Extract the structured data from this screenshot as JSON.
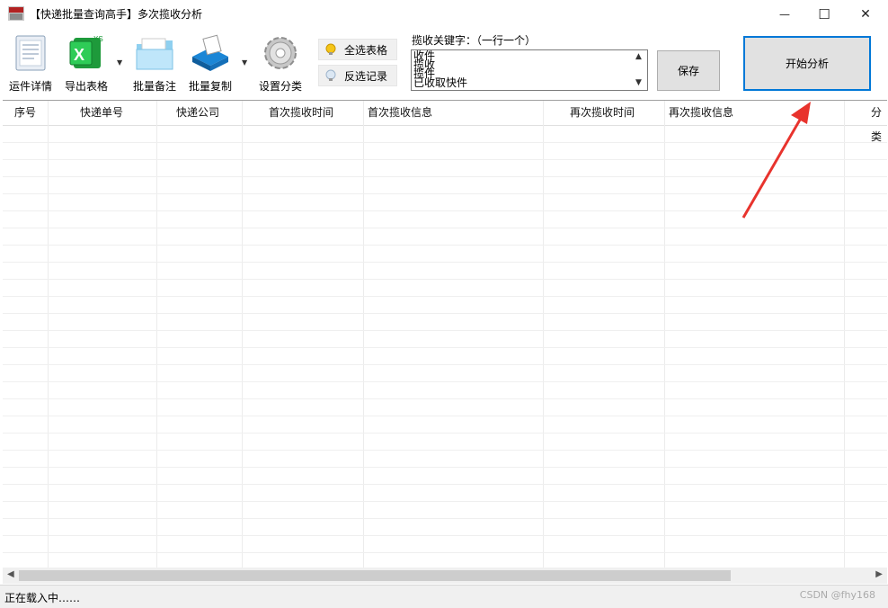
{
  "window": {
    "title": "【快递批量查询高手】多次揽收分析",
    "minimize": "—",
    "maximize": "☐",
    "close": "✕"
  },
  "toolbar": {
    "tools": [
      {
        "label": "运件详情",
        "icon": "document-icon"
      },
      {
        "label": "导出表格",
        "icon": "excel-icon"
      },
      {
        "label": "批量备注",
        "icon": "folder-icon"
      },
      {
        "label": "批量复制",
        "icon": "copy-icon"
      },
      {
        "label": "设置分类",
        "icon": "gear-icon"
      }
    ],
    "select_all": "全选表格",
    "invert_select": "反选记录",
    "keyword_label": "揽收关键字：（一行一个）",
    "keywords": [
      "收件",
      "揽收",
      "揽件",
      "已收取快件"
    ],
    "save": "保存",
    "start": "开始分析"
  },
  "table": {
    "columns": [
      "序号",
      "快递单号",
      "快递公司",
      "首次揽收时间",
      "首次揽收信息",
      "再次揽收时间",
      "再次揽收信息",
      "分类"
    ]
  },
  "status": {
    "text": "正在载入中……",
    "watermark": "CSDN @fhy168"
  },
  "colors": {
    "accent": "#0078d7",
    "annotation_arrow": "#e8332d"
  }
}
